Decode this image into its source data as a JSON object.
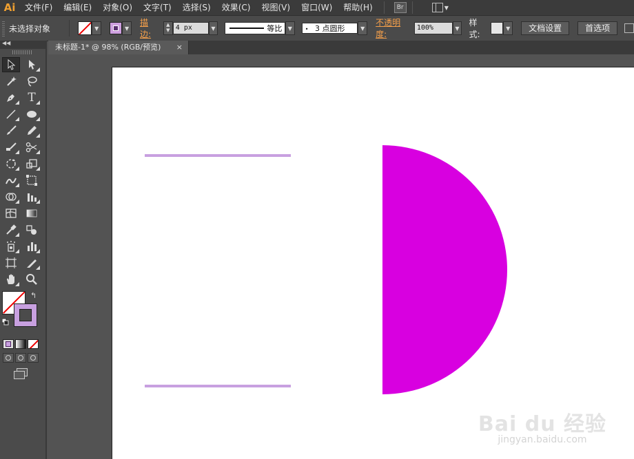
{
  "app": {
    "logo": "Ai",
    "bridge_button": "Br"
  },
  "menus": [
    "文件(F)",
    "编辑(E)",
    "对象(O)",
    "文字(T)",
    "选择(S)",
    "效果(C)",
    "视图(V)",
    "窗口(W)",
    "帮助(H)"
  ],
  "control_bar": {
    "selection_label": "未选择对象",
    "stroke_label": "描边:",
    "stroke_weight": "4 px",
    "stroke_style_label": "等比",
    "brush_profile": "3 点圆形",
    "opacity_label": "不透明度:",
    "opacity_value": "100%",
    "style_label": "样式:",
    "doc_setup_button": "文档设置",
    "preferences_button": "首选项"
  },
  "document_tab": {
    "title": "未标题-1* @ 98% (RGB/预览)",
    "close": "×"
  },
  "tools": {
    "rows": [
      [
        "selection-tool",
        "direct-selection-tool"
      ],
      [
        "magic-wand-tool",
        "lasso-tool"
      ],
      [
        "pen-tool",
        "type-tool"
      ],
      [
        "line-segment-tool",
        "ellipse-tool"
      ],
      [
        "paintbrush-tool",
        "pencil-tool"
      ],
      [
        "blob-brush-tool",
        "scissors-tool"
      ],
      [
        "rotate-tool",
        "scale-tool"
      ],
      [
        "warp-tool",
        "free-transform-tool"
      ],
      [
        "shape-builder-tool",
        "perspective-grid-tool"
      ],
      [
        "mesh-tool",
        "gradient-tool"
      ],
      [
        "eyedropper-tool",
        "blend-tool"
      ],
      [
        "symbol-sprayer-tool",
        "column-graph-tool"
      ],
      [
        "artboard-tool",
        "slice-tool"
      ],
      [
        "hand-tool",
        "zoom-tool"
      ]
    ],
    "type_glyph": "T"
  },
  "colors": {
    "menubar_bg": "#3b3b3b",
    "panel_bg": "#4b4b4b",
    "canvas_bg": "#535353",
    "artboard_bg": "#ffffff",
    "stroke_lilac": "#c8a0e0",
    "shape_magenta": "#d800e0",
    "accent_orange": "#f6a04a"
  },
  "artwork": {
    "shapes": [
      "top-lilac-line",
      "bottom-lilac-line",
      "magenta-half-circle"
    ]
  },
  "watermark": {
    "logo": "Bai du 经验",
    "url": "jingyan.baidu.com"
  }
}
